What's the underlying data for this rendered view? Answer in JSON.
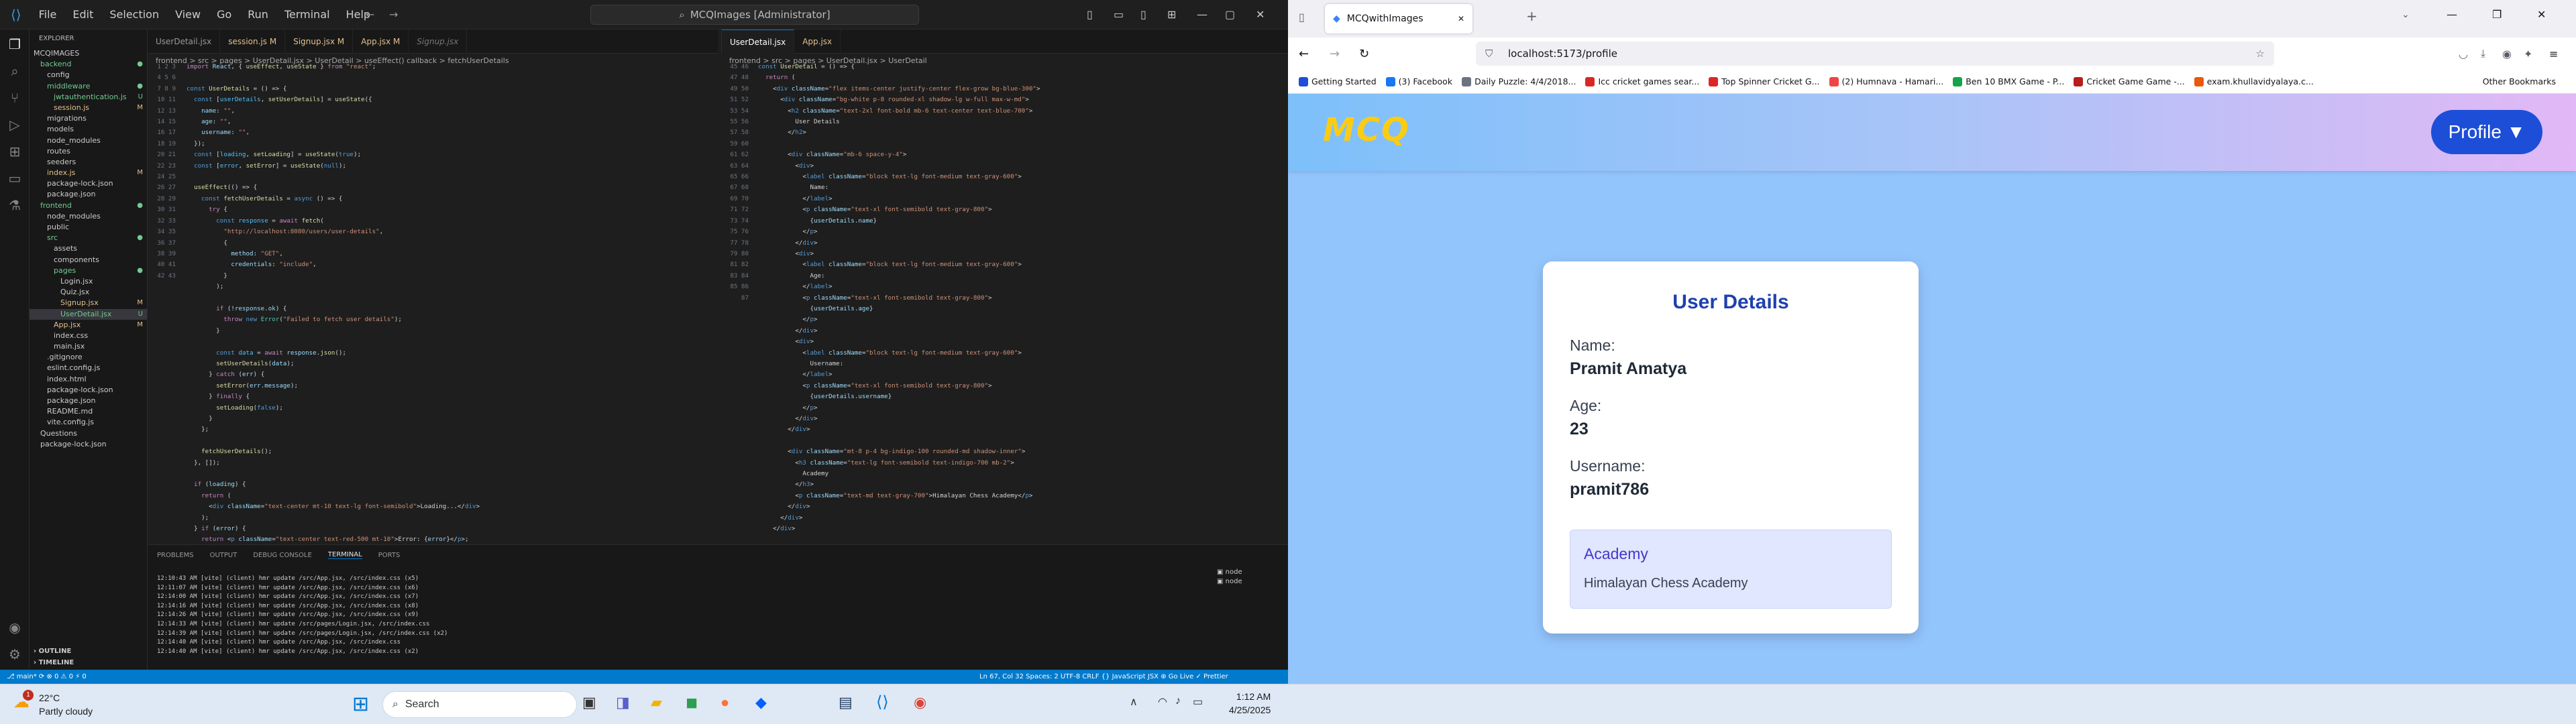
{
  "vscode": {
    "menu": [
      "File",
      "Edit",
      "Selection",
      "View",
      "Go",
      "Run",
      "Terminal",
      "Help"
    ],
    "search": "MCQImages [Administrator]",
    "explorer_title": "EXPLORER",
    "tree": [
      {
        "label": "MCQIMAGES",
        "indent": 0,
        "cls": ""
      },
      {
        "label": "backend",
        "indent": 1,
        "cls": "grn",
        "mark": "●"
      },
      {
        "label": "config",
        "indent": 2,
        "cls": ""
      },
      {
        "label": "middleware",
        "indent": 2,
        "cls": "grn",
        "mark": "●"
      },
      {
        "label": "jwtauthentication.js",
        "indent": 3,
        "cls": "grn",
        "mark": "U"
      },
      {
        "label": "session.js",
        "indent": 3,
        "cls": "mod",
        "mark": "M"
      },
      {
        "label": "migrations",
        "indent": 2,
        "cls": ""
      },
      {
        "label": "models",
        "indent": 2,
        "cls": ""
      },
      {
        "label": "node_modules",
        "indent": 2,
        "cls": ""
      },
      {
        "label": "routes",
        "indent": 2,
        "cls": ""
      },
      {
        "label": "seeders",
        "indent": 2,
        "cls": ""
      },
      {
        "label": "index.js",
        "indent": 2,
        "cls": "mod",
        "mark": "M"
      },
      {
        "label": "package-lock.json",
        "indent": 2,
        "cls": ""
      },
      {
        "label": "package.json",
        "indent": 2,
        "cls": ""
      },
      {
        "label": "frontend",
        "indent": 1,
        "cls": "grn",
        "mark": "●"
      },
      {
        "label": "node_modules",
        "indent": 2,
        "cls": ""
      },
      {
        "label": "public",
        "indent": 2,
        "cls": ""
      },
      {
        "label": "src",
        "indent": 2,
        "cls": "grn",
        "mark": "●"
      },
      {
        "label": "assets",
        "indent": 3,
        "cls": ""
      },
      {
        "label": "components",
        "indent": 3,
        "cls": ""
      },
      {
        "label": "pages",
        "indent": 3,
        "cls": "grn",
        "mark": "●"
      },
      {
        "label": "Login.jsx",
        "indent": 4,
        "cls": ""
      },
      {
        "label": "Quiz.jsx",
        "indent": 4,
        "cls": ""
      },
      {
        "label": "Signup.jsx",
        "indent": 4,
        "cls": "mod",
        "mark": "M"
      },
      {
        "label": "UserDetail.jsx",
        "indent": 4,
        "cls": "grn sb-sel",
        "mark": "U"
      },
      {
        "label": "App.jsx",
        "indent": 3,
        "cls": "mod",
        "mark": "M"
      },
      {
        "label": "index.css",
        "indent": 3,
        "cls": ""
      },
      {
        "label": "main.jsx",
        "indent": 3,
        "cls": ""
      },
      {
        "label": ".gitignore",
        "indent": 2,
        "cls": ""
      },
      {
        "label": "eslint.config.js",
        "indent": 2,
        "cls": ""
      },
      {
        "label": "index.html",
        "indent": 2,
        "cls": ""
      },
      {
        "label": "package-lock.json",
        "indent": 2,
        "cls": ""
      },
      {
        "label": "package.json",
        "indent": 2,
        "cls": ""
      },
      {
        "label": "README.md",
        "indent": 2,
        "cls": ""
      },
      {
        "label": "vite.config.js",
        "indent": 2,
        "cls": ""
      },
      {
        "label": "Questions",
        "indent": 1,
        "cls": ""
      },
      {
        "label": "package-lock.json",
        "indent": 1,
        "cls": ""
      }
    ],
    "outline": "OUTLINE",
    "timeline": "TIMELINE",
    "left_tabs": [
      "UserDetail.jsx",
      "session.js M",
      "Signup.jsx M",
      "App.jsx M",
      "Signup.jsx"
    ],
    "right_tabs": [
      "UserDetail.jsx",
      "App.jsx"
    ],
    "left_crumb": "frontend > src > pages > UserDetail.jsx > UserDetail > useEffect() callback > fetchUserDetails",
    "right_crumb": "frontend > src > pages > UserDetail.jsx > UserDetail",
    "panel_tabs": [
      "PROBLEMS",
      "OUTPUT",
      "DEBUG CONSOLE",
      "TERMINAL",
      "PORTS"
    ],
    "terminal": [
      "12:10:43 AM [vite] (client) hmr update /src/App.jsx, /src/index.css (x5)",
      "12:11:07 AM [vite] (client) hmr update /src/App.jsx, /src/index.css (x6)",
      "12:14:00 AM [vite] (client) hmr update /src/App.jsx, /src/index.css (x7)",
      "12:14:16 AM [vite] (client) hmr update /src/App.jsx, /src/index.css (x8)",
      "12:14:26 AM [vite] (client) hmr update /src/App.jsx, /src/index.css (x9)",
      "12:14:33 AM [vite] (client) hmr update /src/pages/Login.jsx, /src/index.css",
      "12:14:39 AM [vite] (client) hmr update /src/pages/Login.jsx, /src/index.css (x2)",
      "12:14:40 AM [vite] (client) hmr update /src/App.jsx, /src/index.css",
      "12:14:40 AM [vite] (client) hmr update /src/App.jsx, /src/index.css (x2)"
    ],
    "term_list": [
      "node",
      "node"
    ],
    "status_left": "⎇ main* ⟳   ⊗ 0 ⚠ 0   ⚡ 0",
    "status_right": "Ln 67, Col 32   Spaces: 2   UTF-8   CRLF   {} JavaScript JSX   ⊕ Go Live   ✓ Prettier"
  },
  "browser": {
    "tab_title": "MCQwithImages",
    "url": "localhost:5173/profile",
    "bookmarks": [
      "Getting Started",
      "(3) Facebook",
      "Daily Puzzle: 4/4/2018...",
      "Icc cricket games sear...",
      "Top Spinner Cricket G...",
      "(2) Humnava - Hamari...",
      "Ben 10 BMX Game - P...",
      "Cricket Game Game -...",
      "exam.khullavidyalaya.c..."
    ],
    "other_bookmarks": "Other Bookmarks",
    "app": {
      "logo": "MCQ",
      "profile_button": "Profile ▼",
      "card_title": "User Details",
      "name_label": "Name:",
      "name_value": "Pramit Amatya",
      "age_label": "Age:",
      "age_value": "23",
      "username_label": "Username:",
      "username_value": "pramit786",
      "academy_title": "Academy",
      "academy_value": "Himalayan Chess Academy"
    }
  },
  "taskbar": {
    "weather_temp": "22°C",
    "weather_desc": "Partly cloudy",
    "search": "Search",
    "time": "1:12 AM",
    "date": "4/25/2025"
  }
}
